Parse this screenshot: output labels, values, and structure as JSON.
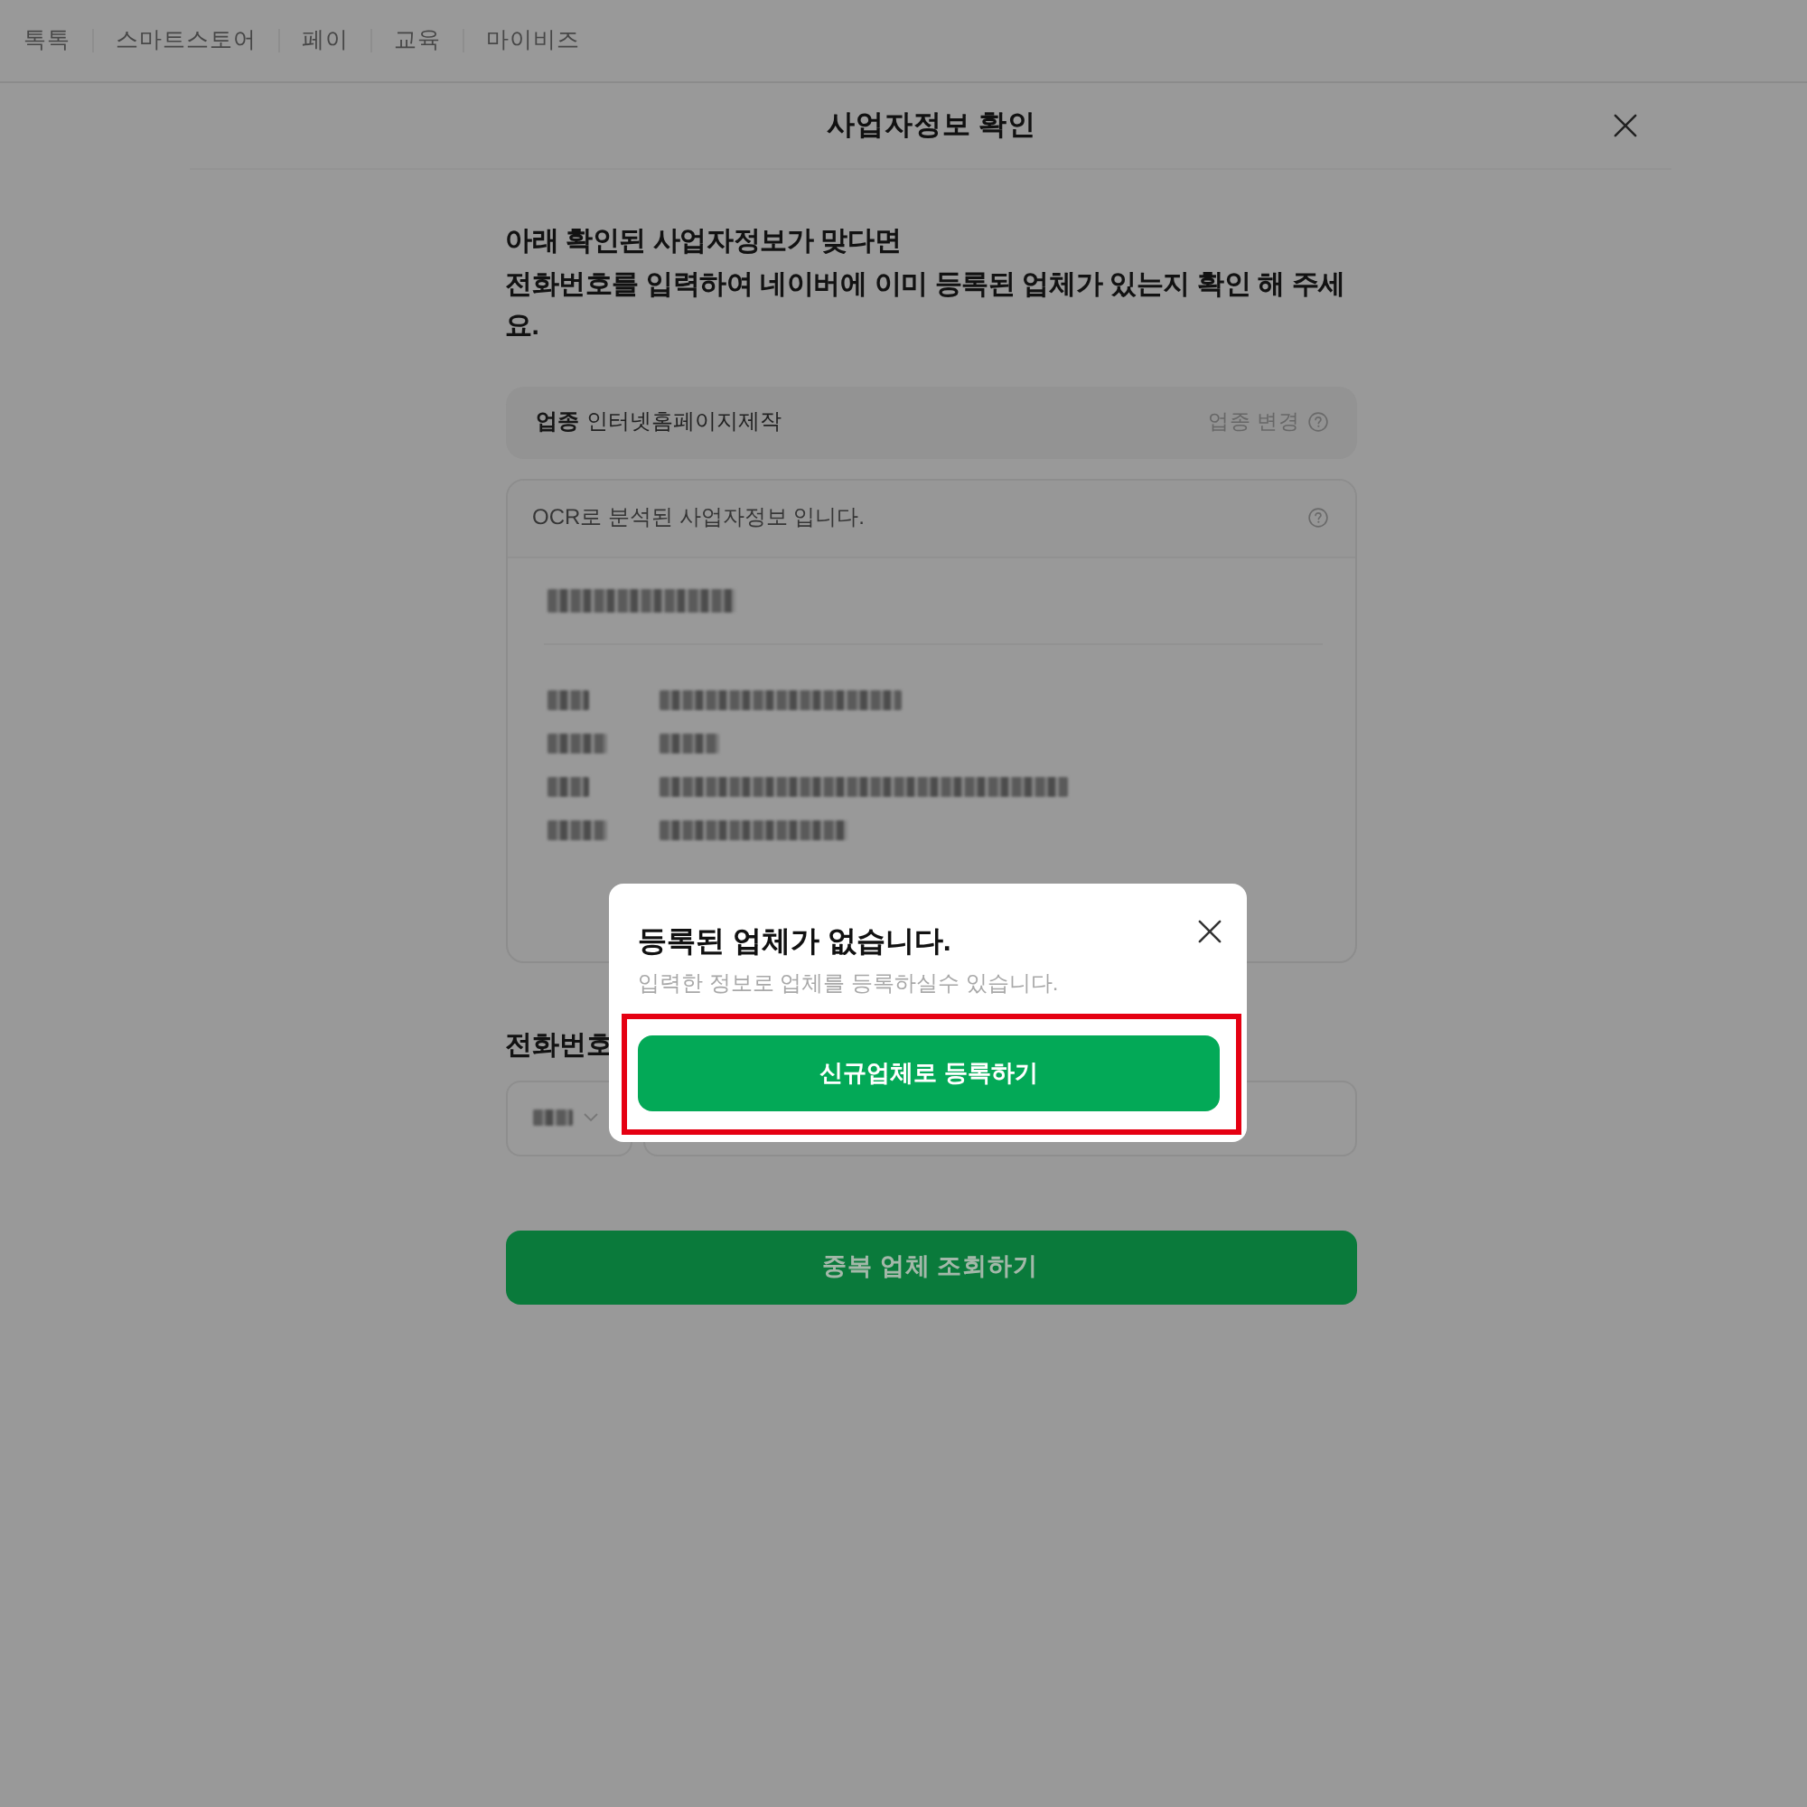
{
  "top_nav": {
    "items": [
      "톡톡",
      "스마트스토어",
      "페이",
      "교육",
      "마이비즈"
    ]
  },
  "page": {
    "title": "사업자정보 확인"
  },
  "intro": "아래 확인된 사업자정보가 맞다면\n전화번호를 입력하여 네이버에 이미 등록된 업체가 있는지 확인 해 주세요.",
  "industry": {
    "label": "업종",
    "value": "인터넷홈페이지제작",
    "change_link": "업종 변경"
  },
  "ocr_card": {
    "caption": "OCR로 분석된 사업자정보 입니다.",
    "blurred": true
  },
  "phone": {
    "label": "전화번호",
    "country_code_blurred": true
  },
  "check_button": "중복 업체 조회하기",
  "popup": {
    "title": "등록된 업체가 없습니다.",
    "message": "입력한 정보로 업체를 등록하실수 있습니다.",
    "button": "신규업체로 등록하기",
    "highlighted": true
  }
}
